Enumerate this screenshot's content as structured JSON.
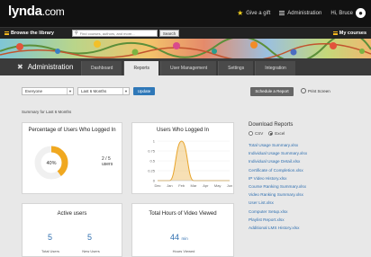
{
  "header": {
    "logo": "lynda",
    "logo_suffix": ".com",
    "give_gift": "Give a gift",
    "administration": "Administration",
    "greeting": "Hi, Bruce"
  },
  "nav": {
    "browse": "Browse the library",
    "search_placeholder": "Find courses, authors, and more...",
    "search_button": "Search",
    "my_courses": "My courses"
  },
  "admin": {
    "title": "Administration",
    "tabs": [
      "Dashboard",
      "Reports",
      "User Management",
      "Settings",
      "Integration"
    ],
    "active_tab": "Reports"
  },
  "filters": {
    "audience": "Everyone",
    "period": "Last 6 Months",
    "update": "Update",
    "schedule": "Schedule a Report",
    "print": "Print Screen",
    "summary": "Summary for Last 6 Months"
  },
  "cards": {
    "logged_in_pct": {
      "title": "Percentage of Users Who Logged In",
      "percent": "40%",
      "percent_value": 40,
      "count": "2 / 5 users"
    },
    "users_logged_in": {
      "title": "Users Who Logged In"
    },
    "active_users": {
      "title": "Active users",
      "total": "5",
      "total_label": "Total Users",
      "new": "5",
      "new_label": "New Users"
    },
    "hours_viewed": {
      "title": "Total Hours of Video Viewed",
      "value": "44",
      "unit": "min",
      "label": "Hours Viewed"
    }
  },
  "chart_data": {
    "type": "area",
    "x": [
      "Dec",
      "Jan",
      "Feb",
      "Mar",
      "Apr",
      "May",
      "Jun"
    ],
    "yticks": [
      "1",
      "0.75",
      "0.5",
      "0.25",
      "0"
    ],
    "ylim": [
      0,
      1
    ],
    "series": [
      {
        "values": [
          0,
          0,
          1,
          0,
          0,
          0,
          0
        ]
      }
    ],
    "color": "#e8a52c"
  },
  "downloads": {
    "title": "Download Reports",
    "format_csv": "CSV",
    "format_excel": "Excel",
    "links": [
      "Total Usage Summary.xlsx",
      "Individual Usage Summary.xlsx",
      "Individual Usage Detail.xlsx",
      "Certificate of Completion.xlsx",
      "IP Video History.xlsx",
      "Course Ranking Summary.xlsx",
      "Video Ranking Summary.xlsx",
      "User List.xlsx",
      "Computer Setup.xlsx",
      "Playlist Report.xlsx",
      "Additional LMS History.xlsx"
    ]
  },
  "colors": {
    "accent": "#2f78b8",
    "donut": "#f0a820",
    "topbar": "#111111"
  }
}
